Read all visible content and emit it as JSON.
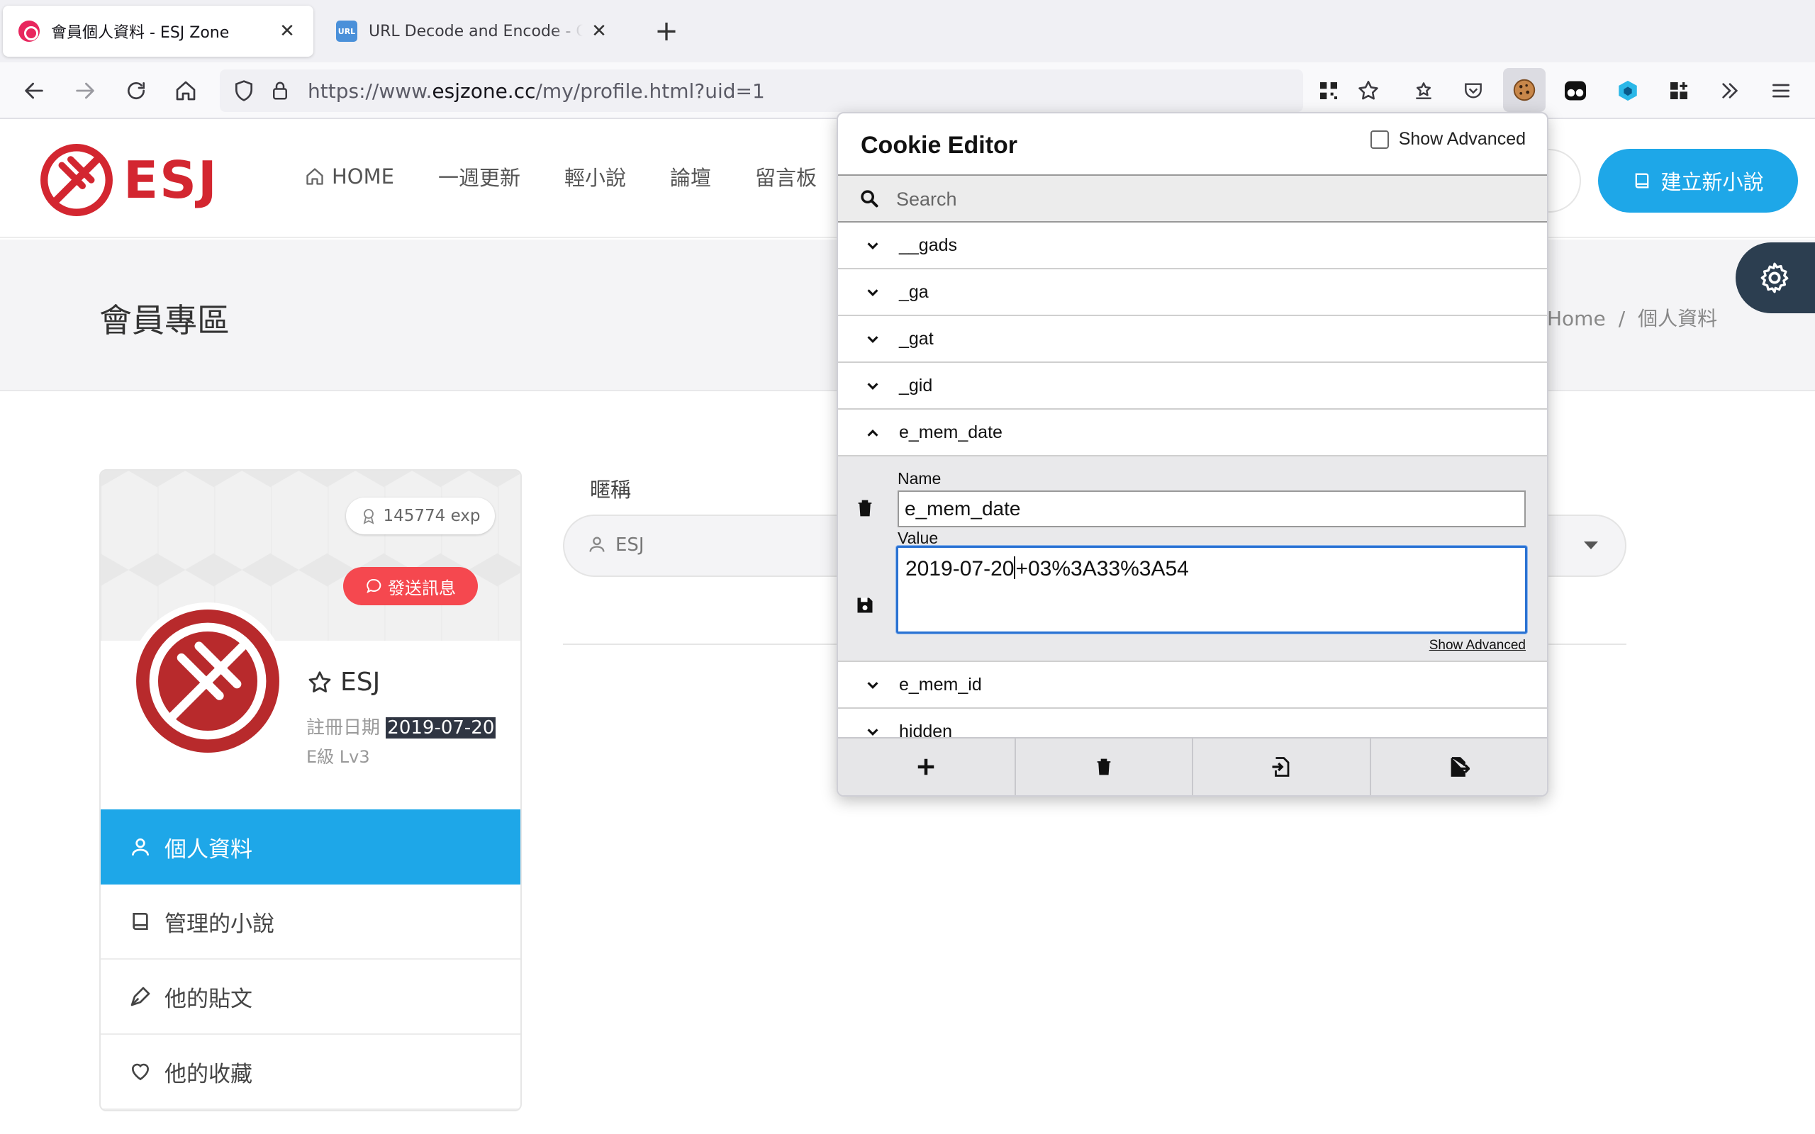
{
  "browser": {
    "tabs": [
      {
        "title": "會員個人資料 - ESJ Zone",
        "active": true
      },
      {
        "title": "URL Decode and Encode - Online",
        "active": false,
        "favicon_text": "URL"
      }
    ],
    "url_prefix": "https://www.",
    "url_domain": "esjzone.cc",
    "url_path": "/my/profile.html?uid=1"
  },
  "site": {
    "logo_text": "ESJ",
    "menu": [
      "HOME",
      "一週更新",
      "輕小說",
      "論壇",
      "留言板"
    ],
    "new_novel_button": "建立新小說",
    "page_title": "會員專區",
    "breadcrumb": [
      "Home",
      "個人資料"
    ],
    "breadcrumb_sep": "/"
  },
  "profile": {
    "exp": "145774 exp",
    "send_message": "發送訊息",
    "username": "ESJ",
    "reg_label": "註冊日期",
    "reg_date": "2019-07-20",
    "level": "E級 Lv3",
    "menu": [
      "個人資料",
      "管理的小說",
      "他的貼文",
      "他的收藏"
    ]
  },
  "form": {
    "nickname_label": "暱稱",
    "nickname_value": "ESJ"
  },
  "cookie_editor": {
    "title": "Cookie Editor",
    "show_advanced": "Show Advanced",
    "search_placeholder": "Search",
    "cookies_before": [
      "__gads",
      "_ga",
      "_gat",
      "_gid"
    ],
    "expanded_cookie": "e_mem_date",
    "name_label": "Name",
    "name_value": "e_mem_date",
    "value_label": "Value",
    "value_before_cursor": "2019-07-20",
    "value_after_cursor": "+03%3A33%3A54",
    "show_advanced_link": "Show Advanced",
    "cookies_after": [
      "e_mem_id",
      "hidden"
    ]
  },
  "colors": {
    "accent_blue": "#1ea7e8",
    "brand_red": "#d32630",
    "message_red": "#f5484f",
    "focus_blue": "#2a72d2"
  }
}
